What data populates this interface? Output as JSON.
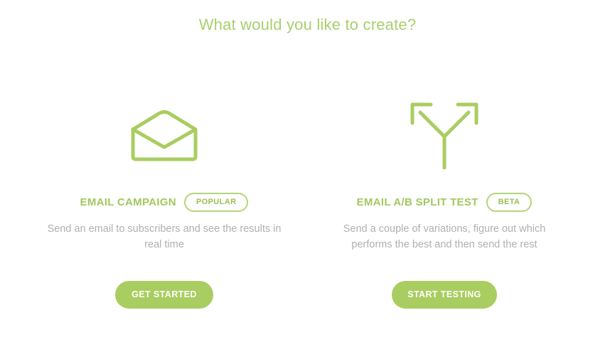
{
  "header": {
    "title": "What would you like to create?"
  },
  "colors": {
    "accent": "#a9cd60",
    "text_muted": "#b0b0b0"
  },
  "options": [
    {
      "icon": "envelope-open-icon",
      "title": "EMAIL CAMPAIGN",
      "badge": "POPULAR",
      "description": "Send an email to subscribers and see the results in real time",
      "cta": "GET STARTED"
    },
    {
      "icon": "split-arrows-icon",
      "title": "EMAIL A/B SPLIT TEST",
      "badge": "BETA",
      "description": "Send a couple of variations, figure out which performs the best and then send the rest",
      "cta": "START TESTING"
    }
  ]
}
